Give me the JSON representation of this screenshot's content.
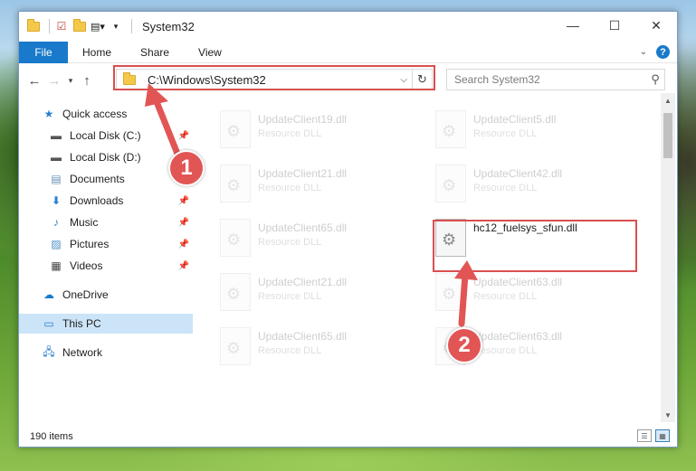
{
  "window": {
    "title": "System32",
    "controls": {
      "minimize": "—",
      "maximize": "☐",
      "close": "✕"
    }
  },
  "ribbon": {
    "tabs": [
      "File",
      "Home",
      "Share",
      "View"
    ]
  },
  "nav": {
    "address": "C:\\Windows\\System32",
    "search_placeholder": "Search System32"
  },
  "sidebar": {
    "items": [
      {
        "label": "Quick access",
        "icon": "star-icon",
        "pinned": false
      },
      {
        "label": "Local Disk (C:)",
        "icon": "drive-icon",
        "pinned": true
      },
      {
        "label": "Local Disk (D:)",
        "icon": "drive-icon",
        "pinned": false
      },
      {
        "label": "Documents",
        "icon": "documents-icon",
        "pinned": true
      },
      {
        "label": "Downloads",
        "icon": "download-icon",
        "pinned": true
      },
      {
        "label": "Music",
        "icon": "music-icon",
        "pinned": true
      },
      {
        "label": "Pictures",
        "icon": "pictures-icon",
        "pinned": true
      },
      {
        "label": "Videos",
        "icon": "videos-icon",
        "pinned": true
      },
      {
        "label": "OneDrive",
        "icon": "cloud-icon",
        "pinned": false
      },
      {
        "label": "This PC",
        "icon": "computer-icon",
        "pinned": false,
        "active": true
      },
      {
        "label": "Network",
        "icon": "network-icon",
        "pinned": false
      }
    ]
  },
  "files": [
    {
      "name": "UpdateClient19.dll",
      "type": "Resource DLL",
      "faded": true
    },
    {
      "name": "UpdateClient5.dll",
      "type": "Resource DLL",
      "faded": true
    },
    {
      "name": "UpdateClient21.dll",
      "type": "Resource DLL",
      "faded": true
    },
    {
      "name": "UpdateClient42.dll",
      "type": "Resource DLL",
      "faded": true
    },
    {
      "name": "UpdateClient65.dll",
      "type": "Resource DLL",
      "faded": true
    },
    {
      "name": "hc12_fuelsys_sfun.dll",
      "type": "",
      "faded": false
    },
    {
      "name": "UpdateClient21.dll",
      "type": "Resource DLL",
      "faded": true
    },
    {
      "name": "UpdateClient63.dll",
      "type": "Resource DLL",
      "faded": true
    },
    {
      "name": "UpdateClient65.dll",
      "type": "Resource DLL",
      "faded": true
    },
    {
      "name": "UpdateClient63.dll",
      "type": "Resource DLL",
      "faded": true
    }
  ],
  "status": {
    "item_count": "190 items"
  },
  "annotations": {
    "step1": "1",
    "step2": "2",
    "color": "#e25555"
  }
}
